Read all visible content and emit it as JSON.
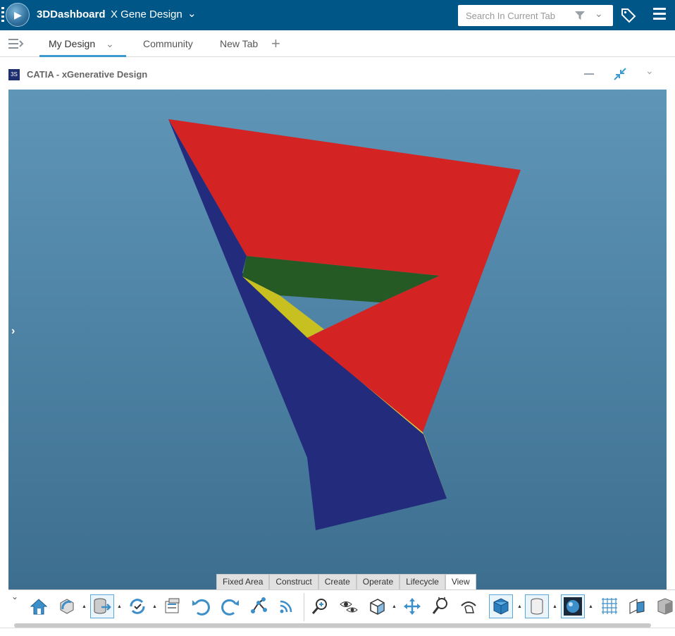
{
  "topbar": {
    "brand": "3DDashboard",
    "dashboard_name": "X Gene Design",
    "search_placeholder": "Search In Current Tab"
  },
  "tabs": [
    {
      "label": "My Design",
      "active": true
    },
    {
      "label": "Community",
      "active": false
    },
    {
      "label": "New Tab",
      "active": false
    }
  ],
  "widget": {
    "title": "CATIA - xGenerative Design"
  },
  "command_tabs": [
    {
      "label": "Fixed Area",
      "active": false
    },
    {
      "label": "Construct",
      "active": false
    },
    {
      "label": "Create",
      "active": false
    },
    {
      "label": "Operate",
      "active": false
    },
    {
      "label": "Lifecycle",
      "active": false
    },
    {
      "label": "View",
      "active": true
    }
  ],
  "toolbar_icons": [
    "home-icon",
    "rotate-view-icon",
    "database-export-icon",
    "update-cycle-icon",
    "properties-icon",
    "undo-icon",
    "redo-icon",
    "graph-nodes-icon",
    "feed-icon",
    "zoom-fit-icon",
    "hide-show-icon",
    "cube-outline-icon",
    "pan-icon",
    "zoom-icon",
    "rotate-hand-icon",
    "view-cube-icon",
    "cylinder-icon",
    "sphere-render-icon",
    "grid-icon",
    "section-view-icon",
    "shading-icon"
  ],
  "colors": {
    "header_bg": "#005686",
    "model_red": "#d32323",
    "model_blue": "#232b7d",
    "model_yellow": "#d4cc4a",
    "model_green": "#255a25",
    "tab_accent": "#3d9ad1"
  }
}
